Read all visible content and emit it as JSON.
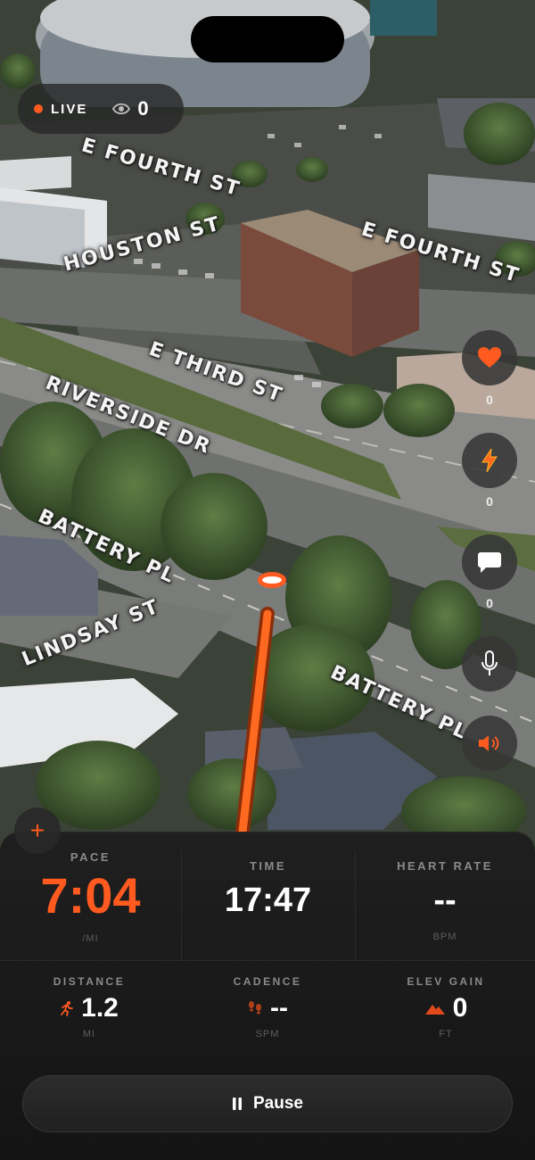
{
  "live": {
    "label": "LIVE",
    "viewers": "0"
  },
  "streets": [
    {
      "text": "E FOURTH ST"
    },
    {
      "text": "HOUSTON ST"
    },
    {
      "text": "E FOURTH ST"
    },
    {
      "text": "E THIRD ST"
    },
    {
      "text": "RIVERSIDE DR"
    },
    {
      "text": "BATTERY PL"
    },
    {
      "text": "LINDSAY ST"
    },
    {
      "text": "BATTERY PL"
    }
  ],
  "reactions": {
    "hearts": "0",
    "boosts": "0",
    "comments": "0"
  },
  "stats": {
    "pace": {
      "label": "PACE",
      "value": "7:04",
      "unit": "/MI"
    },
    "time": {
      "label": "TIME",
      "value": "17:47"
    },
    "heart_rate": {
      "label": "HEART RATE",
      "value": "--",
      "unit": "BPM"
    },
    "distance": {
      "label": "DISTANCE",
      "value": "1.2",
      "unit": "MI"
    },
    "cadence": {
      "label": "CADENCE",
      "value": "--",
      "unit": "SPM"
    },
    "elev_gain": {
      "label": "ELEV GAIN",
      "value": "0",
      "unit": "FT"
    }
  },
  "pause_label": "Pause",
  "colors": {
    "accent": "#ff5a1f",
    "panel": "#1a1a1a"
  },
  "icons": [
    "eye-icon",
    "heart-icon",
    "bolt-icon",
    "chat-icon",
    "mic-icon",
    "speaker-icon",
    "plus-icon",
    "runner-icon",
    "footsteps-icon",
    "mountain-icon",
    "pause-icon"
  ]
}
